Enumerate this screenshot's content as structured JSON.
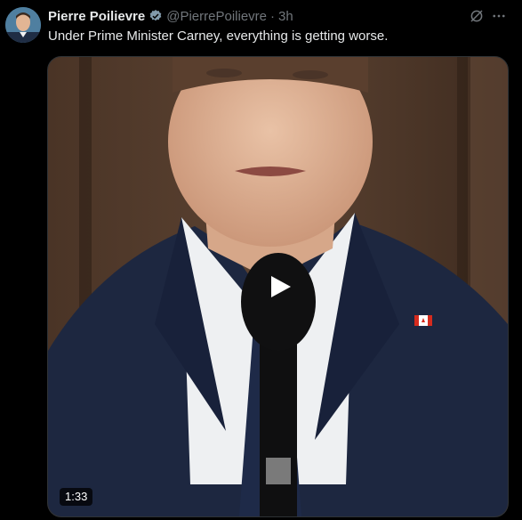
{
  "post": {
    "author_name": "Pierre Poilievre",
    "handle": "@PierrePoilievre",
    "separator": "·",
    "time": "3h",
    "text": "Under Prime Minister Carney, everything is getting worse.",
    "video_duration": "1:33"
  },
  "icons": {
    "verified": "verified-badge-icon",
    "grok": "grok-icon",
    "more": "more-options-icon",
    "play": "play-icon"
  },
  "colors": {
    "background": "#000000",
    "primary_text": "#e7e9ea",
    "secondary_text": "#71767b",
    "verified": "#829aab"
  }
}
